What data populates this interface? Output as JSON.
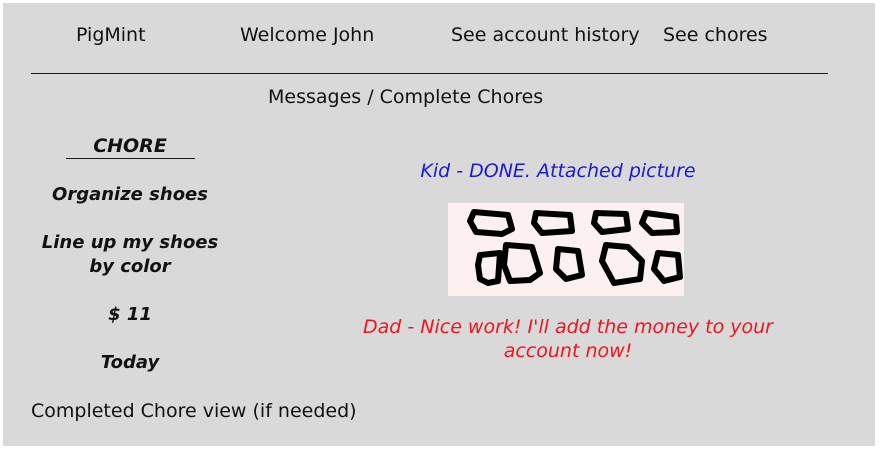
{
  "nav": {
    "brand": "PigMint",
    "welcome": "Welcome John",
    "account_history": "See account history",
    "chores": "See chores"
  },
  "page": {
    "subtitle": "Messages / Complete Chores",
    "footer_note": "Completed Chore view (if needed)"
  },
  "chore": {
    "header": "CHORE",
    "name": "Organize shoes",
    "description": "Line up my shoes by color",
    "amount": "$ 11",
    "due": "Today"
  },
  "messages": {
    "kid": "Kid - DONE. Attached picture",
    "dad": "Dad - Nice work! I'll add the money to your account now!",
    "kid_color": "#1a19d6",
    "dad_color": "#f0141e"
  },
  "attachment": {
    "icon": "shoes-sketch-image"
  }
}
